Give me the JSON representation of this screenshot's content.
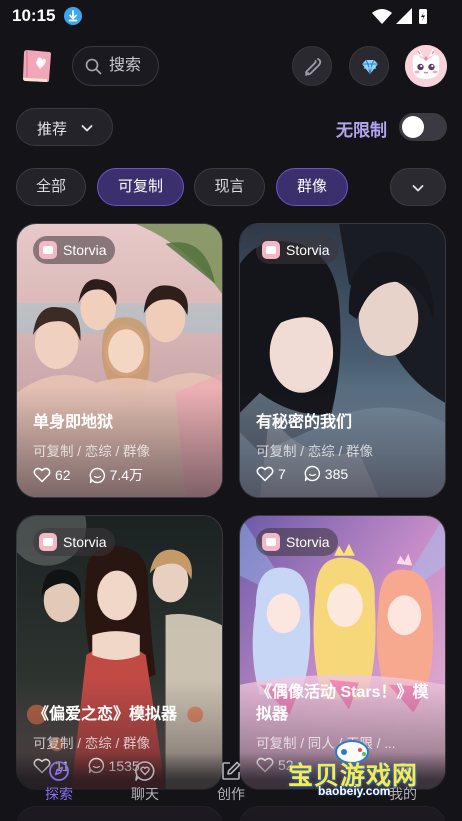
{
  "status": {
    "time": "10:15"
  },
  "header": {
    "search_placeholder": "搜索"
  },
  "sort": {
    "label": "推荐"
  },
  "unlimited": {
    "label": "无限制",
    "enabled": false
  },
  "filters": [
    {
      "label": "全部",
      "active": false
    },
    {
      "label": "可复制",
      "active": true
    },
    {
      "label": "现言",
      "active": false
    },
    {
      "label": "群像",
      "active": true
    }
  ],
  "cards": [
    {
      "brand": "Storvia",
      "title": "单身即地狱",
      "tags": "可复制 / 恋综 / 群像",
      "likes": "62",
      "comments": "7.4万"
    },
    {
      "brand": "Storvia",
      "title": "有秘密的我们",
      "tags": "可复制 / 恋综 / 群像",
      "likes": "7",
      "comments": "385"
    },
    {
      "brand": "Storvia",
      "title": "《偏爱之恋》模拟器",
      "tags": "可复制 / 恋综 / 群像",
      "likes": "11",
      "comments": "1535"
    },
    {
      "brand": "Storvia",
      "title": "《偶像活动 Stars！》模拟器",
      "tags": "可复制 / 同人 / 无限 / ...",
      "likes": "52",
      "comments": ""
    }
  ],
  "nav": [
    {
      "label": "探索",
      "icon": "explore-icon",
      "active": true
    },
    {
      "label": "聊天",
      "icon": "chat-icon",
      "active": false
    },
    {
      "label": "创作",
      "icon": "create-icon",
      "active": false
    },
    {
      "label": "我的",
      "icon": "profile-icon",
      "active": false
    }
  ],
  "watermark": {
    "text": "宝贝游戏网",
    "url": "baobeiy.com"
  },
  "colors": {
    "accent": "#8b6df0",
    "chip_active": "#3c2f6e",
    "background": "#141318"
  }
}
